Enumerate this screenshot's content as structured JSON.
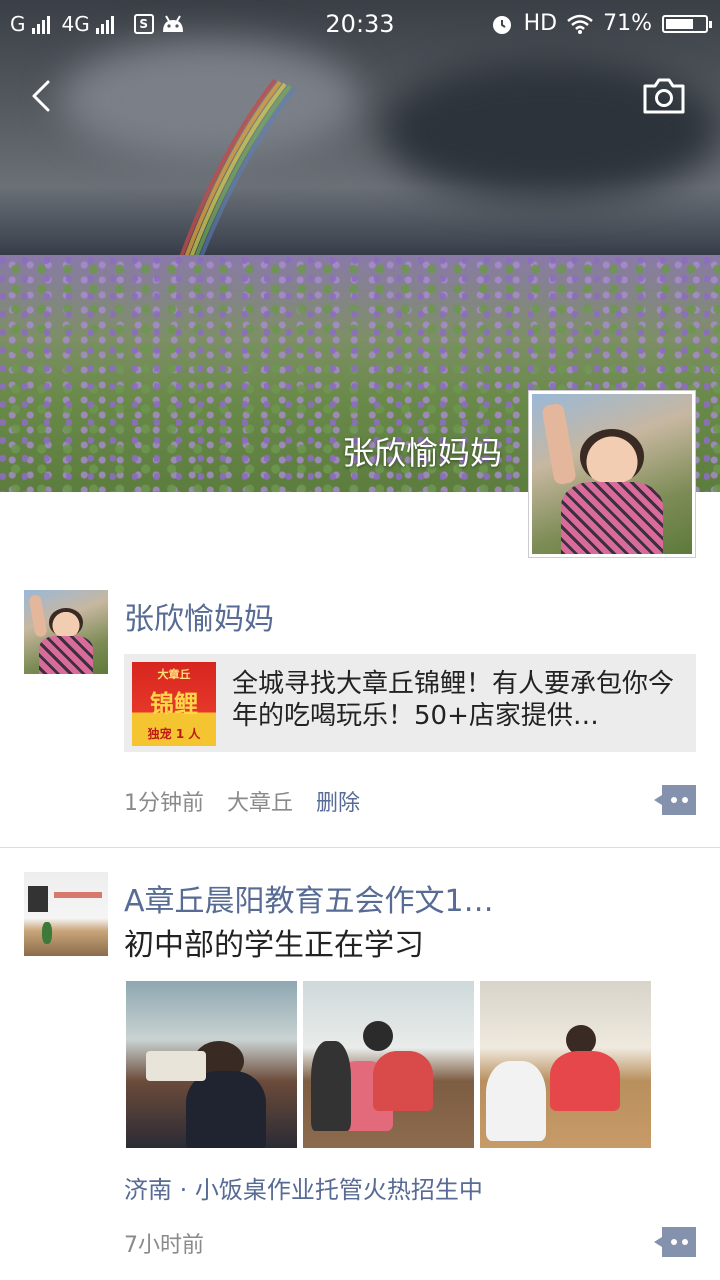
{
  "status_bar": {
    "carrier1": "G",
    "network": "4G",
    "time": "20:33",
    "hd": "HD",
    "battery": "71%",
    "battery_level": 0.71
  },
  "header": {
    "back_icon": "chevron-left-icon",
    "camera_icon": "camera-icon",
    "cover_name": "张欣愉妈妈"
  },
  "posts": [
    {
      "author": "张欣愉妈妈",
      "share": {
        "thumb_top": "大章丘",
        "thumb_main": "锦鲤",
        "thumb_bottom": "独宠 1 人",
        "text": "全城寻找大章丘锦鲤！有人要承包你今年的吃喝玩乐！50+店家提供…"
      },
      "time": "1分钟前",
      "location": "大章丘",
      "delete_label": "删除",
      "more_icon": "comment-more-icon"
    },
    {
      "author": "A章丘晨阳教育五会作文1…",
      "text": "初中部的学生正在学习",
      "location": "济南 · 小饭桌作业托管火热招生中",
      "time": "7小时前",
      "more_icon": "comment-more-icon"
    }
  ],
  "colors": {
    "link": "#576b95",
    "meta": "#8a8a8a",
    "card_bg": "#ececec"
  }
}
